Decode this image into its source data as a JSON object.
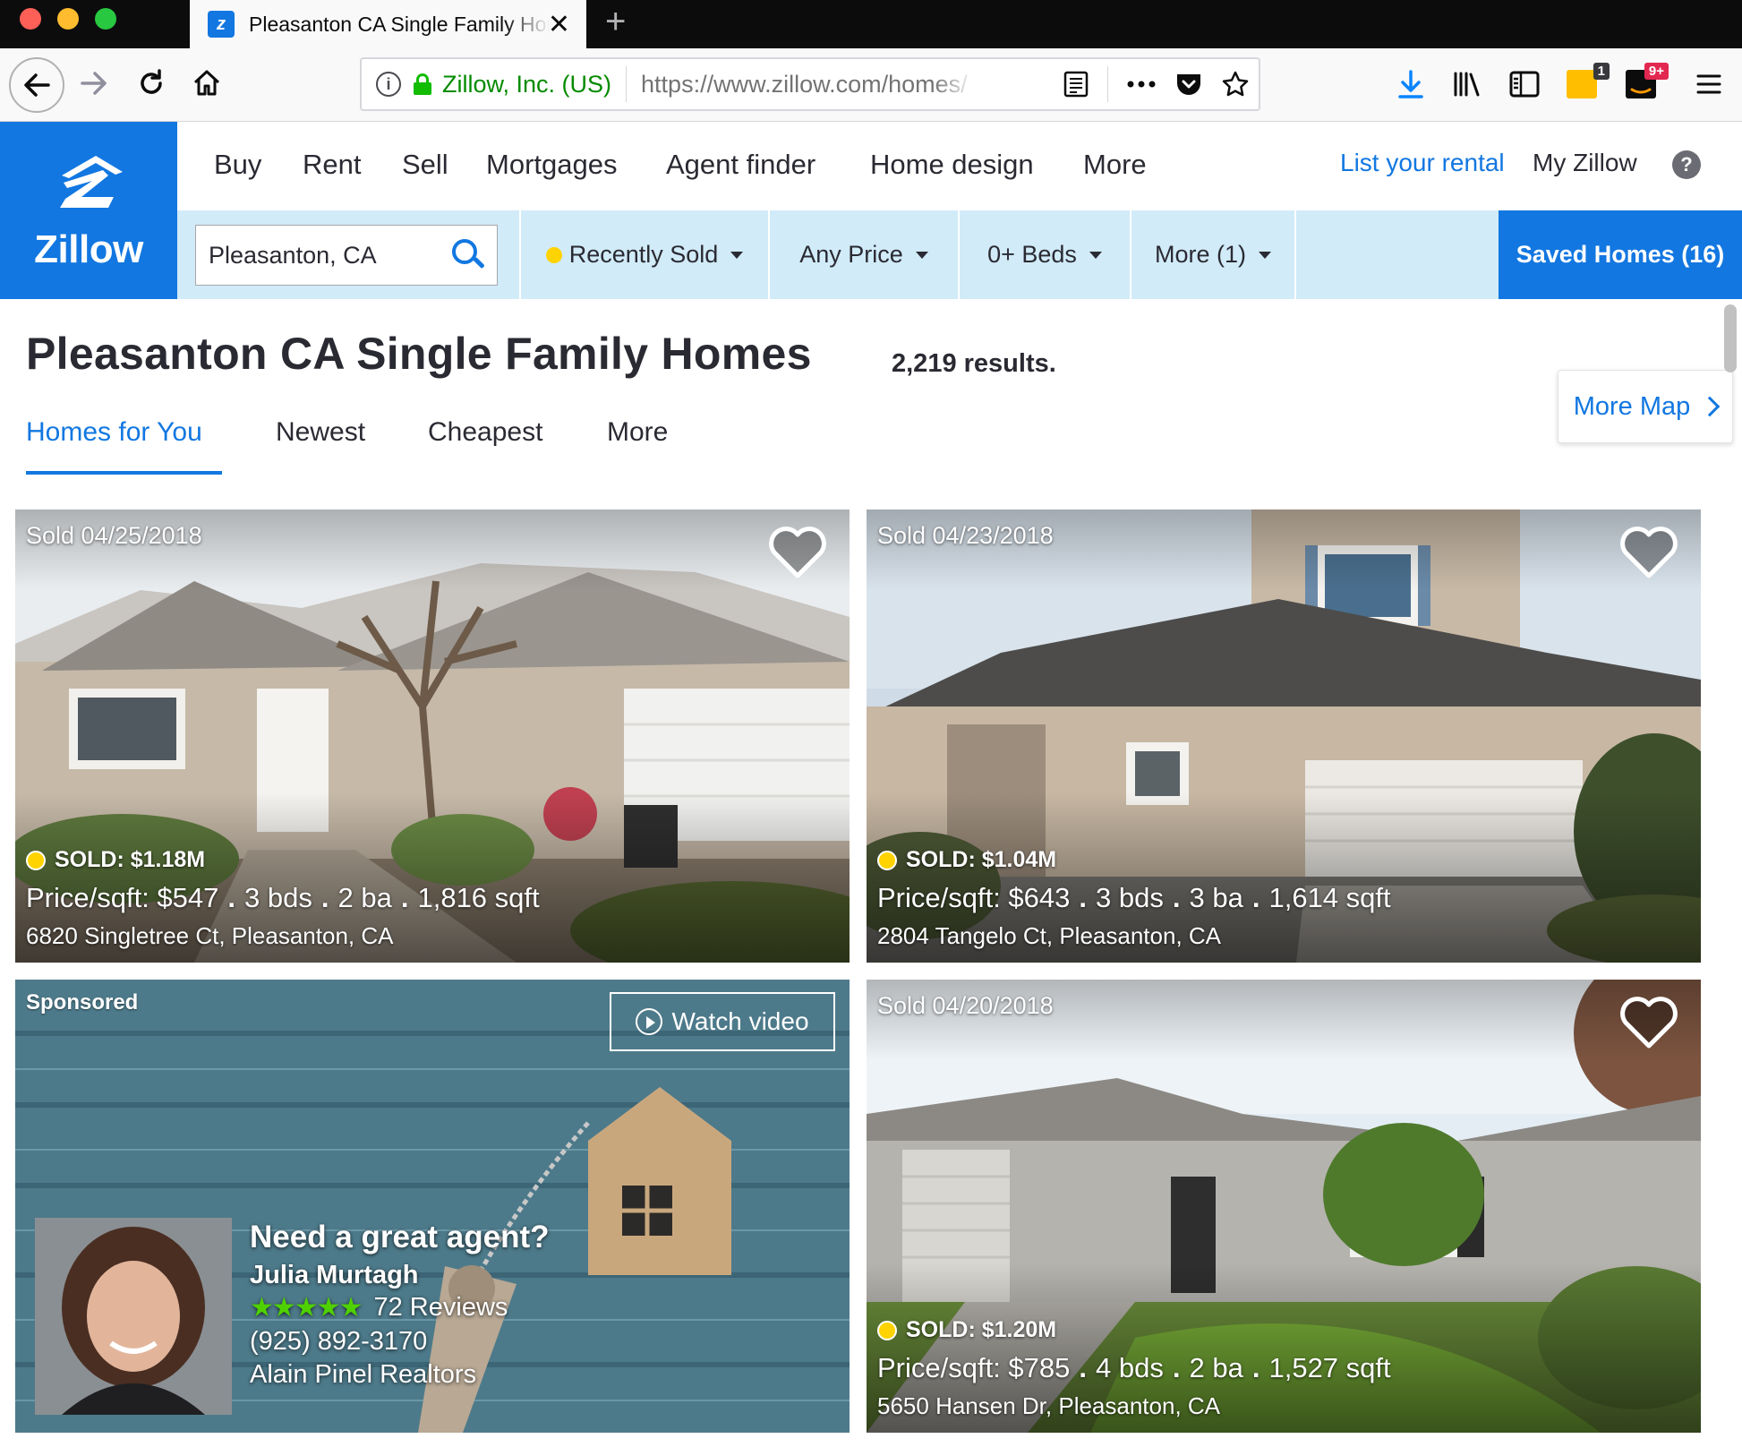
{
  "browser": {
    "tab_title": "Pleasanton CA Single Family Homes For Sale - Zillow",
    "tab_close": "✕",
    "new_tab": "+",
    "url_org": "Zillow, Inc. (US)",
    "url": "https://www.zillow.com/homes/",
    "info_glyph": "i",
    "reader_icon": "reader-view-icon",
    "badge_notes": "1",
    "badge_amazon": "9+"
  },
  "logo": {
    "text": "Zillow"
  },
  "nav": {
    "buy": "Buy",
    "rent": "Rent",
    "sell": "Sell",
    "mortgages": "Mortgages",
    "agent_finder": "Agent finder",
    "home_design": "Home design",
    "more": "More",
    "list_rental": "List your rental",
    "my_zillow": "My Zillow",
    "help": "?"
  },
  "filters": {
    "search_value": "Pleasanton, CA",
    "status": "Recently Sold",
    "price": "Any Price",
    "beds": "0+ Beds",
    "more": "More (1)",
    "saved_homes": "Saved Homes (16)"
  },
  "list": {
    "title": "Pleasanton CA Single Family Homes",
    "results": "2,219 results.",
    "sort_tabs": [
      "Homes for You",
      "Newest",
      "Cheapest",
      "More"
    ],
    "more_map": "More Map"
  },
  "listings": [
    {
      "sold_date": "Sold 04/25/2018",
      "sold_price": "SOLD: $1.18M",
      "price_sqft": "Price/sqft: $547",
      "beds": "3 bds",
      "baths": "2 ba",
      "sqft": "1,816 sqft",
      "address": "6820 Singletree Ct, Pleasanton, CA"
    },
    {
      "sold_date": "Sold 04/23/2018",
      "sold_price": "SOLD: $1.04M",
      "price_sqft": "Price/sqft: $643",
      "beds": "3 bds",
      "baths": "3 ba",
      "sqft": "1,614 sqft",
      "address": "2804 Tangelo Ct, Pleasanton, CA"
    },
    {
      "sold_date": "Sold 04/20/2018",
      "sold_price": "SOLD: $1.20M",
      "price_sqft": "Price/sqft: $785",
      "beds": "4 bds",
      "baths": "2 ba",
      "sqft": "1,527 sqft",
      "address": "5650 Hansen Dr, Pleasanton, CA"
    }
  ],
  "sponsored": {
    "label": "Sponsored",
    "watch_video": "Watch video",
    "headline": "Need a great agent?",
    "agent_name": "Julia Murtagh",
    "stars": "★★★★★",
    "reviews": "72 Reviews",
    "phone": "(925) 892-3170",
    "company": "Alain Pinel Realtors"
  },
  "colors": {
    "brand_blue": "#1277e1",
    "filter_bar": "#d1ebf8",
    "sold_dot": "#ffd300",
    "star_green": "#4fd100"
  }
}
